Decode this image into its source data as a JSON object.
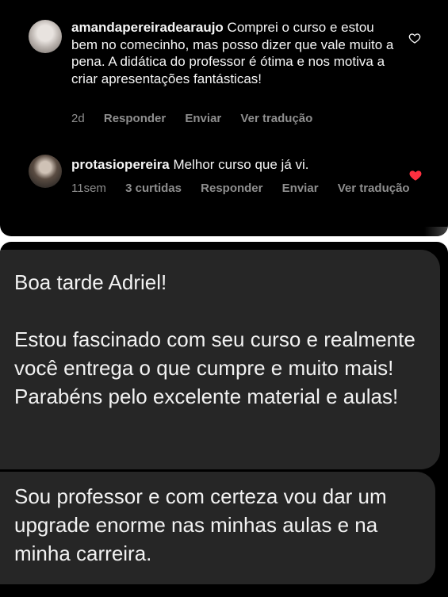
{
  "comments": [
    {
      "username": "amandapereiradearaujo",
      "text": " Comprei o curso e estou bem no comecinho, mas posso dizer que vale muito a pena. A didática do professor é ótima e nos motiva a criar apresentações fantásticas!",
      "time": "2d",
      "actions": [
        "Responder",
        "Enviar",
        "Ver tradução"
      ],
      "like_icon": "heart-outline-icon"
    },
    {
      "username": "protasiopereira",
      "text": " Melhor curso que já vi.",
      "time": "11sem",
      "likes": "3 curtidas",
      "actions": [
        "Responder",
        "Enviar",
        "Ver tradução"
      ],
      "like_icon": "heart-filled-icon",
      "like_color": "#ff3040"
    }
  ],
  "messages": [
    {
      "lines": [
        "Boa tarde Adriel!",
        "",
        "Estou fascinado com seu curso e realmente você entrega o que cumpre e muito mais! Parabéns pelo excelente material e aulas!"
      ]
    },
    {
      "lines": [
        "Sou professor e com certeza vou dar um upgrade enorme nas minhas aulas e na minha carreira."
      ]
    }
  ],
  "colors": {
    "background": "#000000",
    "bubble": "#262626",
    "text": "#f5f5f5",
    "meta": "#8e8e8e",
    "heart_red": "#ff3040"
  }
}
